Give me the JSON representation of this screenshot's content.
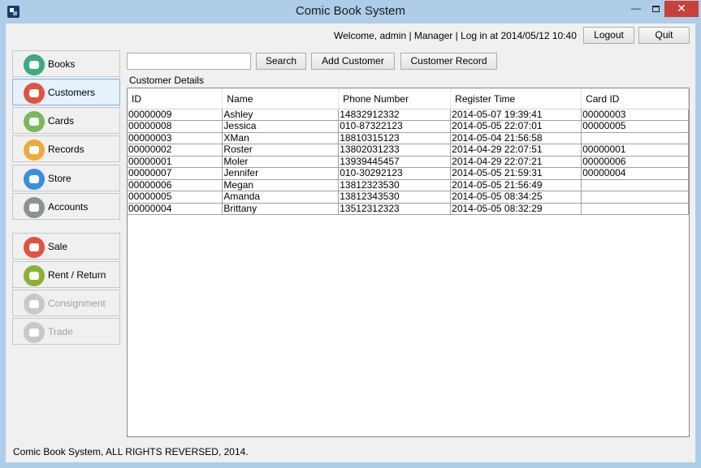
{
  "window": {
    "title": "Comic Book System",
    "minimize": "—",
    "close": "✕"
  },
  "header": {
    "welcome": "Welcome, admin | Manager | Log in at 2014/05/12 10:40",
    "logout_label": "Logout",
    "quit_label": "Quit"
  },
  "sidebar": {
    "items": [
      {
        "label": "Books",
        "icon": "chat-bubble-icon",
        "color": "#3eaa7d",
        "active": false,
        "enabled": true
      },
      {
        "label": "Customers",
        "icon": "user-icon",
        "color": "#e2523f",
        "active": true,
        "enabled": true
      },
      {
        "label": "Cards",
        "icon": "monitor-icon",
        "color": "#7ab85a",
        "active": false,
        "enabled": true
      },
      {
        "label": "Records",
        "icon": "cloud-icon",
        "color": "#f2a93b",
        "active": false,
        "enabled": true
      },
      {
        "label": "Store",
        "icon": "phone-icon",
        "color": "#3a8fdc",
        "active": false,
        "enabled": true
      },
      {
        "label": "Accounts",
        "icon": "gear-icon",
        "color": "#8a9497",
        "active": false,
        "enabled": true
      },
      {
        "label": "Sale",
        "icon": "receipt-icon",
        "color": "#e2523f",
        "active": false,
        "enabled": true
      },
      {
        "label": "Rent / Return",
        "icon": "video-camera-icon",
        "color": "#8bb133",
        "active": false,
        "enabled": true
      },
      {
        "label": "Consignment",
        "icon": "cloud-icon",
        "color": "#c8c8c8",
        "active": false,
        "enabled": false
      },
      {
        "label": "Trade",
        "icon": "user-icon",
        "color": "#c8c8c8",
        "active": false,
        "enabled": false
      }
    ]
  },
  "toolbar": {
    "search_value": "",
    "search_label": "Search",
    "add_label": "Add Customer",
    "record_label": "Customer Record"
  },
  "details": {
    "title": "Customer Details",
    "columns": [
      "ID",
      "Name",
      "Phone Number",
      "Register Time",
      "Card ID"
    ],
    "rows": [
      [
        "00000009",
        "Ashley",
        "14832912332",
        "2014-05-07 19:39:41",
        "00000003"
      ],
      [
        "00000008",
        "Jessica",
        "010-87322123",
        "2014-05-05 22:07:01",
        "00000005"
      ],
      [
        "00000003",
        "XMan",
        "18810315123",
        "2014-05-04 21:56:58",
        ""
      ],
      [
        "00000002",
        "Roster",
        "13802031233",
        "2014-04-29 22:07:51",
        "00000001"
      ],
      [
        "00000001",
        "Moler",
        "13939445457",
        "2014-04-29 22:07:21",
        "00000006"
      ],
      [
        "00000007",
        "Jennifer",
        "010-30292123",
        "2014-05-05 21:59:31",
        "00000004"
      ],
      [
        "00000006",
        "Megan",
        "13812323530",
        "2014-05-05 21:56:49",
        ""
      ],
      [
        "00000005",
        "Amanda",
        "13812343530",
        "2014-05-05 08:34:25",
        ""
      ],
      [
        "00000004",
        "Brittany",
        "13512312323",
        "2014-05-05 08:32:29",
        ""
      ]
    ]
  },
  "footer": {
    "text": "Comic Book System, ALL RIGHTS REVERSED, 2014."
  }
}
